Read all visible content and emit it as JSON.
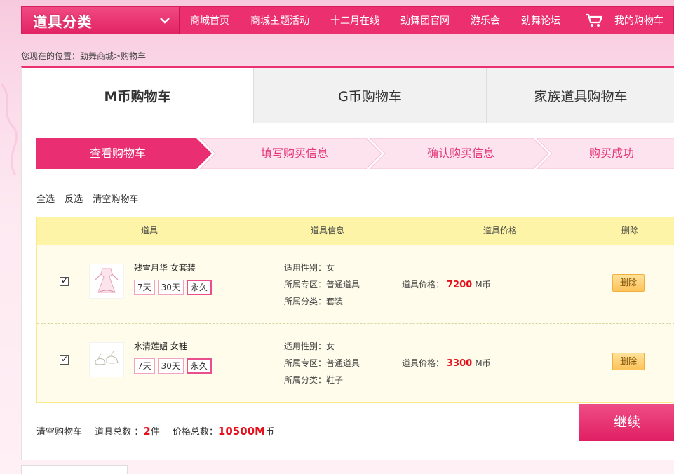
{
  "nav": {
    "category_title": "道具分类",
    "items": [
      "商城首页",
      "商城主题活动",
      "十二月在线",
      "劲舞团官网",
      "游乐会",
      "劲舞论坛"
    ],
    "cart_label": "我的购物车"
  },
  "breadcrumb": "您现在的位置：劲舞商城>购物车",
  "currency_tabs": [
    "M币购物车",
    "G币购物车",
    "家族道具购物车"
  ],
  "steps": [
    "查看购物车",
    "填写购买信息",
    "确认购买信息",
    "购买成功"
  ],
  "selection_actions": {
    "select_all": "全选",
    "invert": "反选",
    "clear": "清空购物车"
  },
  "table": {
    "headers": [
      "道具",
      "道具信息",
      "道具价格",
      "删除"
    ],
    "rows": [
      {
        "checked": true,
        "name": "残雪月华 女套装",
        "durations": [
          "7天",
          "30天",
          "永久"
        ],
        "selected_duration": "永久",
        "gender": "适用性别：女",
        "zone": "所属专区：普通道具",
        "category": "所属分类：套装",
        "price_label": "道具价格：",
        "price": "7200",
        "price_unit": "M币",
        "delete_label": "删除"
      },
      {
        "checked": true,
        "name": "水清莲媚 女鞋",
        "durations": [
          "7天",
          "30天",
          "永久"
        ],
        "selected_duration": "永久",
        "gender": "适用性别：女",
        "zone": "所属专区：普通道具",
        "category": "所属分类：鞋子",
        "price_label": "道具价格：",
        "price": "3300",
        "price_unit": "M币",
        "delete_label": "删除"
      }
    ]
  },
  "footer": {
    "clear_label": "清空购物车",
    "total_items_label": "道具总数 ：",
    "total_items": "2",
    "total_items_unit": "件",
    "total_price_label": "价格总数：",
    "total_price": "10500M",
    "total_price_unit": "币",
    "continue_label": "继续"
  },
  "colors": {
    "brand_pink": "#ec2f6f",
    "price_red": "#e5101c",
    "table_header_yellow": "#fdf4a7"
  }
}
